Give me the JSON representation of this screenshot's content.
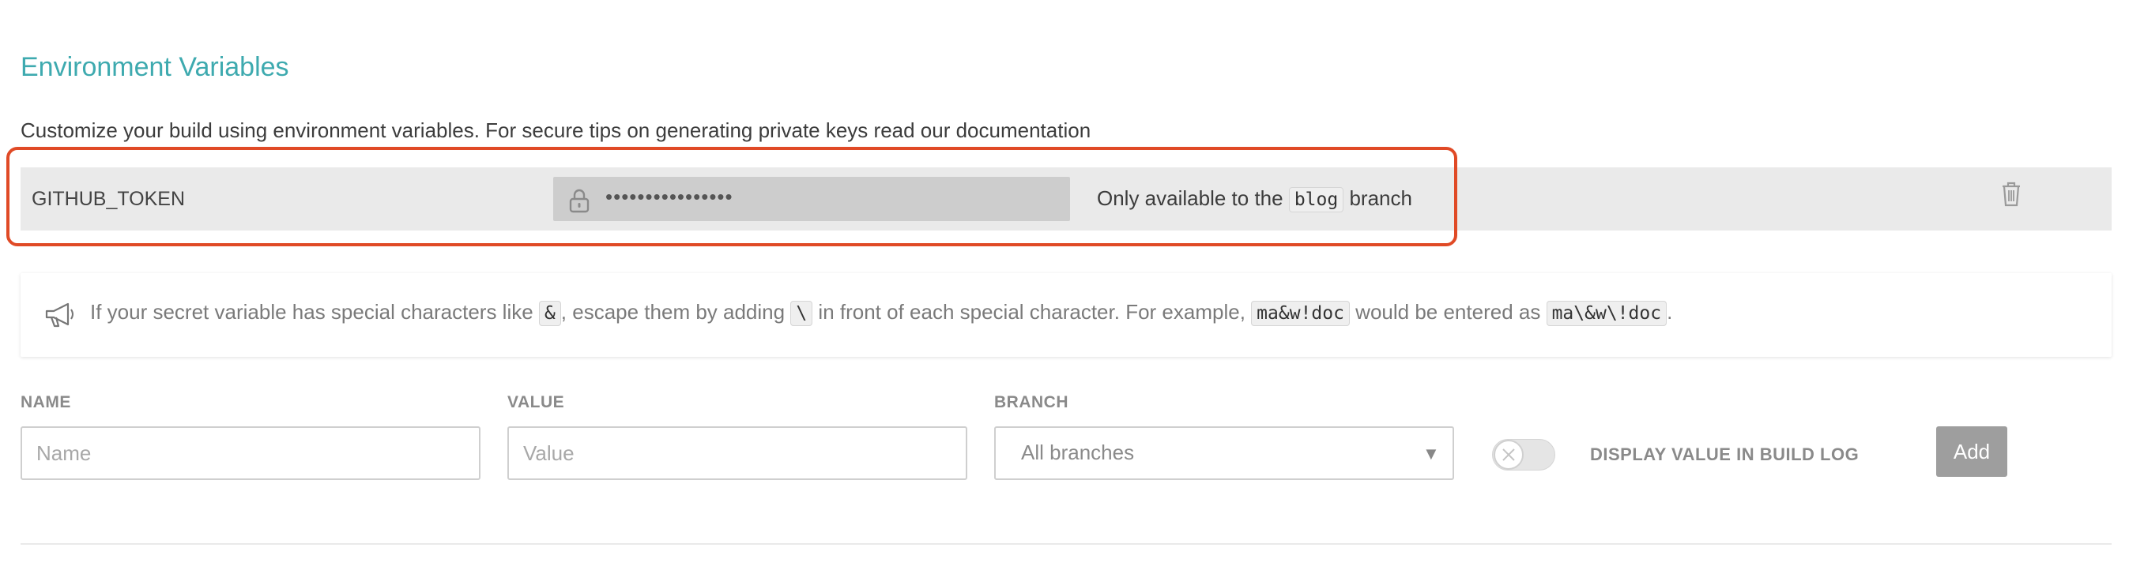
{
  "section": {
    "title": "Environment Variables",
    "description": "Customize your build using environment variables. For secure tips on generating private keys read our documentation"
  },
  "variable": {
    "name": "GITHUB_TOKEN",
    "masked_value": "••••••••••••••••",
    "branch_prefix": "Only available to the",
    "branch": "blog",
    "branch_suffix": "branch"
  },
  "notice": {
    "part1": "If your secret variable has special characters like",
    "code1": "&",
    "part2": ", escape them by adding",
    "code2": "\\",
    "part3": "in front of each special character. For example,",
    "code3": "ma&w!doc",
    "part4": "would be entered as",
    "code4": "ma\\&w\\!doc",
    "part5": "."
  },
  "form": {
    "name_label": "NAME",
    "name_placeholder": "Name",
    "value_label": "VALUE",
    "value_placeholder": "Value",
    "branch_label": "BRANCH",
    "branch_selected": "All branches",
    "toggle_label": "DISPLAY VALUE IN BUILD LOG",
    "add_label": "Add"
  },
  "colors": {
    "accent": "#3eaaaf",
    "highlight": "#e04a26",
    "button": "#9e9e9e"
  },
  "icons": {
    "lock": "lock-icon",
    "trash": "trash-icon",
    "megaphone": "megaphone-icon",
    "toggle_off": "close-icon",
    "dropdown": "chevron-down-icon"
  }
}
